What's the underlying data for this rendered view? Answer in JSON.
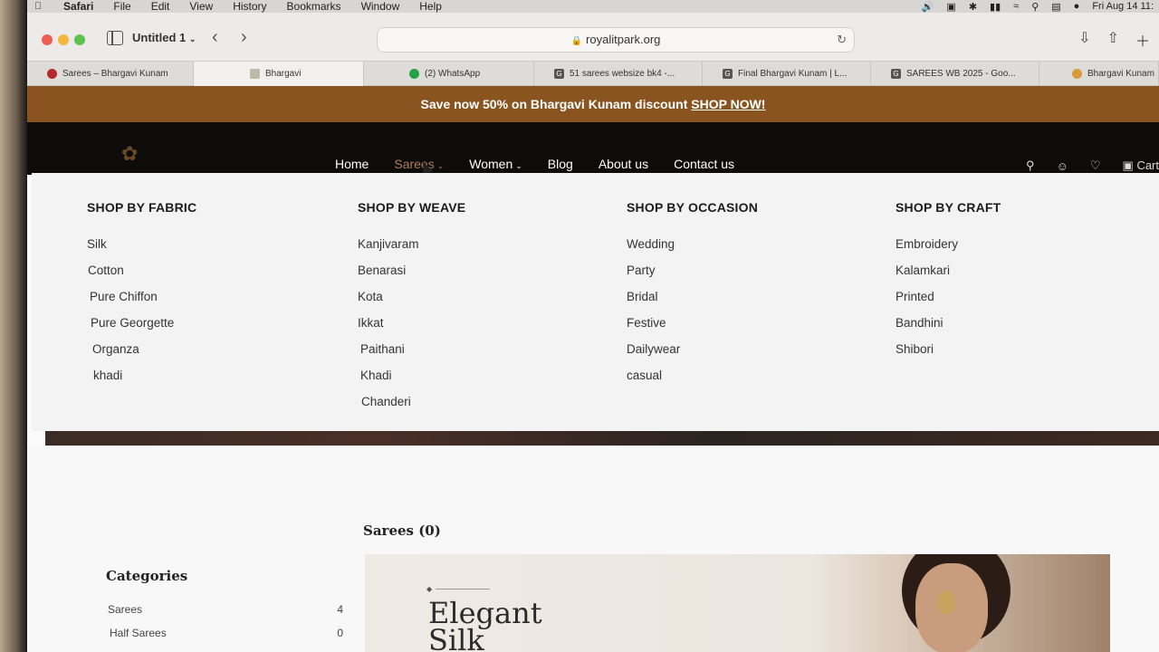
{
  "menubar": {
    "app": "Safari",
    "items": [
      "File",
      "Edit",
      "View",
      "History",
      "Bookmarks",
      "Window",
      "Help"
    ],
    "clock": "Fri Aug 14  11:"
  },
  "browser": {
    "window_title": "Untitled 1",
    "url": "royalitpark.org",
    "tabs": [
      {
        "label": "Sarees – Bhargavi Kunam",
        "icon": "red-round-favicon"
      },
      {
        "label": "Bhargavi",
        "icon": "image-favicon"
      },
      {
        "label": "(2) WhatsApp",
        "icon": "whatsapp-icon"
      },
      {
        "label": "51 sarees websize bk4 -...",
        "icon": "google-docs-icon"
      },
      {
        "label": "Final Bhargavi Kunam | L...",
        "icon": "google-docs-icon"
      },
      {
        "label": "SAREES WB 2025 - Goo...",
        "icon": "google-docs-icon"
      },
      {
        "label": "Bhargavi Kunam",
        "icon": "orange-favicon"
      }
    ]
  },
  "promo": {
    "text": "Save now 50% on Bhargavi Kunam discount ",
    "link": "SHOP NOW!"
  },
  "nav": {
    "items": [
      {
        "label": "Home",
        "caret": false
      },
      {
        "label": "Sarees",
        "caret": true
      },
      {
        "label": "Women",
        "caret": true
      },
      {
        "label": "Blog",
        "caret": false
      },
      {
        "label": "About us",
        "caret": false
      },
      {
        "label": "Contact us",
        "caret": false
      }
    ],
    "cart_label": "Cart"
  },
  "mega_menu": {
    "columns": [
      {
        "title": "SHOP BY FABRIC",
        "items": [
          "Silk",
          "Cotton",
          "Pure Chiffon",
          "Pure Georgette",
          "Organza",
          "khadi"
        ]
      },
      {
        "title": "SHOP BY WEAVE",
        "items": [
          "Kanjivaram",
          "Benarasi",
          "Kota",
          "Ikkat",
          "Paithani",
          "Khadi",
          "Chanderi"
        ]
      },
      {
        "title": "SHOP BY OCCASION",
        "items": [
          "Wedding",
          "Party",
          "Bridal",
          "Festive",
          "Dailywear",
          "casual"
        ]
      },
      {
        "title": "SHOP BY CRAFT",
        "items": [
          "Embroidery",
          "Kalamkari",
          "Printed",
          "Bandhini",
          "Shibori"
        ]
      }
    ]
  },
  "results": {
    "title": "Sarees (0)"
  },
  "categories": {
    "title": "Categories",
    "items": [
      {
        "label": "Sarees",
        "count": "4"
      },
      {
        "label": "Half Sarees",
        "count": "0"
      }
    ]
  },
  "banner": {
    "line1": "Elegant",
    "line2": "Silk"
  },
  "colors": {
    "promo_bg": "#8a5420",
    "header_bg": "#0e0c0a",
    "active_nav": "#b07b58",
    "highlight_marker": "#35f0a2"
  }
}
